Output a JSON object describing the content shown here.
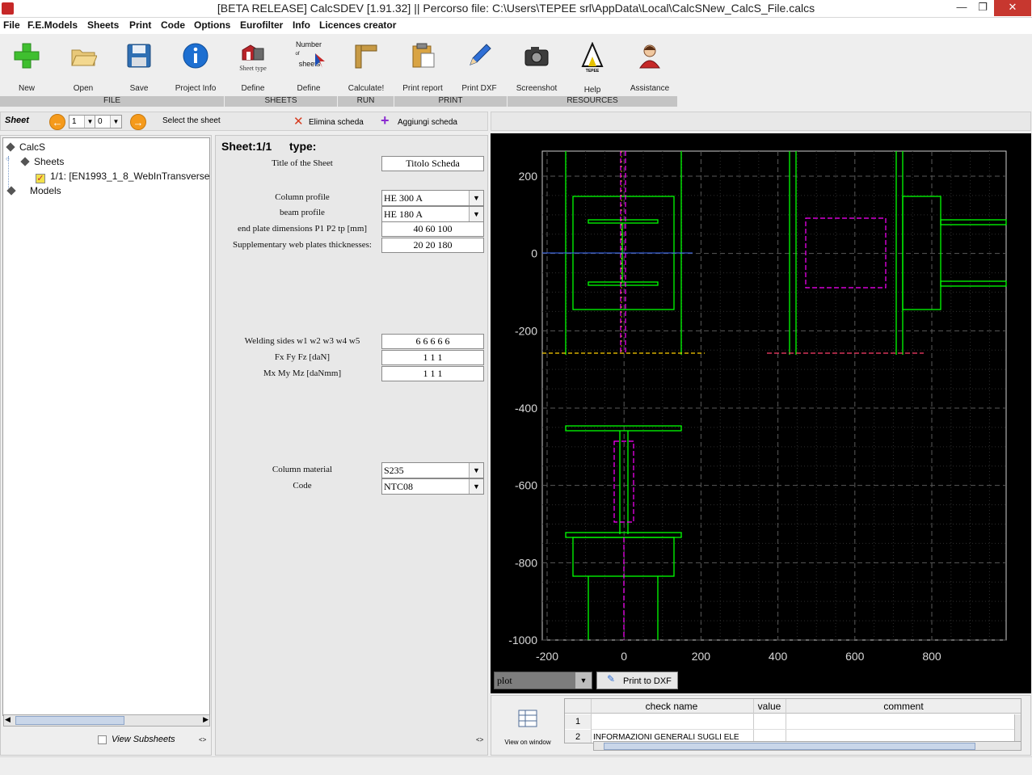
{
  "window": {
    "title": "[BETA RELEASE] CalcSDEV [1.91.32] || Percorso file: C:\\Users\\TEPEE srl\\AppData\\Local\\CalcSNew_CalcS_File.calcs",
    "min_glyph": "—",
    "max_glyph": "❐",
    "close_glyph": "✕"
  },
  "menu": [
    "File",
    "F.E.Models",
    "Sheets",
    "Print",
    "Code",
    "Options",
    "Eurofilter",
    "Info",
    "Licences creator"
  ],
  "toolbar": {
    "tools": [
      {
        "label": "New",
        "icon": "plus-icon"
      },
      {
        "label": "Open",
        "icon": "folder-icon"
      },
      {
        "label": "Save",
        "icon": "floppy-icon"
      },
      {
        "label": "Project Info",
        "icon": "info-icon"
      },
      {
        "label": "Define",
        "icon": "sheet-type-icon",
        "caption": "Sheet type"
      },
      {
        "label": "Define",
        "icon": "number-of-sheets-icon",
        "caption_top": "Number",
        "caption_mid": "of",
        "caption_bot": "sheets"
      },
      {
        "label": "Calculate!",
        "icon": "ruler-icon"
      },
      {
        "label": "Print report",
        "icon": "clipboard-icon"
      },
      {
        "label": "Print DXF",
        "icon": "pencil-icon"
      },
      {
        "label": "Screenshot",
        "icon": "camera-icon"
      },
      {
        "label": "Help",
        "icon": "tepee-icon",
        "caption": "TEPEE"
      },
      {
        "label": "Assistance",
        "icon": "assistant-icon"
      }
    ],
    "groups": [
      "FILE",
      "SHEETS",
      "RUN",
      "PRINT",
      "RESOURCES"
    ]
  },
  "sheetbar": {
    "title": "Sheet",
    "spin1": "1",
    "spin2": "0",
    "select_label": "Select the sheet",
    "delete_label": "Elimina scheda",
    "add_label": "Aggiungi scheda"
  },
  "tree": {
    "root": "CalcS",
    "sheets": "Sheets",
    "sheet_item": "1/1: [EN1993_1_8_WebInTransverse",
    "models": "Models",
    "view_subsheets": "View Subsheets",
    "collapse_glyph": "<>"
  },
  "form": {
    "sheet_no": "Sheet:1/1",
    "type_label": "type:",
    "title_label": "Title of the Sheet",
    "title_value": "Titolo Scheda",
    "column_profile_label": "Column profile",
    "column_profile_value": "HE 300 A",
    "beam_profile_label": "beam profile",
    "beam_profile_value": "HE 180 A",
    "end_plate_label": "end plate dimensions P1 P2 tp [mm]",
    "end_plate_value": "40 60 100",
    "web_plates_label": "Supplementary web plates thicknesses:",
    "web_plates_value": "20 20 180",
    "welding_label": "Welding sides w1 w2 w3 w4 w5",
    "welding_value": "6 6 6 6 6",
    "forces_label": "Fx Fy Fz [daN]",
    "forces_value": "1 1 1",
    "moments_label": "Mx My Mz [daNmm]",
    "moments_value": "1 1 1",
    "material_label": "Column material",
    "material_value": "S235",
    "code_label": "Code",
    "code_value": "NTC08",
    "collapse_glyph": "<>"
  },
  "plot": {
    "x_ticks": [
      "-200",
      "0",
      "200",
      "400",
      "600",
      "800"
    ],
    "y_ticks": [
      "200",
      "0",
      "-200",
      "-400",
      "-600",
      "-800",
      "-1000"
    ],
    "selector_value": "plot",
    "print_dxf_label": "Print to DXF"
  },
  "checks": {
    "view_label": "View on window",
    "columns": [
      "check name",
      "value",
      "comment"
    ],
    "rows": [
      {
        "n": "1",
        "name": "",
        "value": "",
        "comment": ""
      },
      {
        "n": "2",
        "name": "INFORMAZIONI GENERALI SUGLI ELE",
        "value": "",
        "comment": ""
      }
    ]
  },
  "colors": {
    "structure": "#00ff00",
    "centerline": "#ff00ff",
    "grid": "#4a4a4a",
    "axis_line": "#3a6bff",
    "beam_axis": "#ffd000",
    "accent_orange": "#f59a1b"
  }
}
